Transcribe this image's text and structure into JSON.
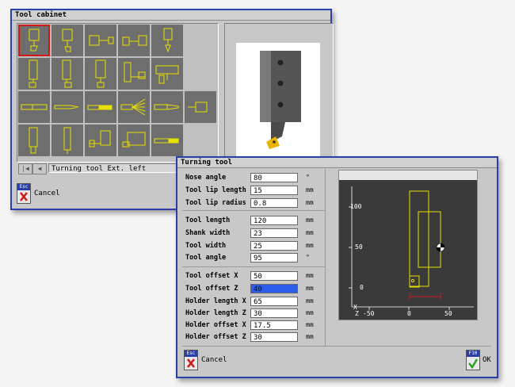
{
  "cabinet": {
    "title": "Tool cabinet",
    "selected_tool_label": "Turning tool Ext. left",
    "cancel_key": "Esc",
    "cancel_label": "Cancel",
    "nav_first_icon": "first-page-icon",
    "nav_prev_icon": "prev-page-icon"
  },
  "turning": {
    "title": "Turning tool",
    "fields": [
      {
        "label": "Nose angle",
        "value": "80",
        "unit": "°"
      },
      {
        "label": "Tool lip length",
        "value": "15",
        "unit": "mm"
      },
      {
        "label": "Tool lip radius",
        "value": "0.8",
        "unit": "mm"
      },
      {
        "label": "Tool length",
        "value": "120",
        "unit": "mm"
      },
      {
        "label": "Shank width",
        "value": "23",
        "unit": "mm"
      },
      {
        "label": "Tool width",
        "value": "25",
        "unit": "mm"
      },
      {
        "label": "Tool angle",
        "value": "95",
        "unit": "°"
      },
      {
        "label": "Tool offset X",
        "value": "50",
        "unit": "mm"
      },
      {
        "label": "Tool offset Z",
        "value": "40",
        "unit": "mm"
      },
      {
        "label": "Holder length X",
        "value": "65",
        "unit": "mm"
      },
      {
        "label": "Holder length Z",
        "value": "30",
        "unit": "mm"
      },
      {
        "label": "Holder offset X",
        "value": "17.5",
        "unit": "mm"
      },
      {
        "label": "Holder offset Z",
        "value": "30",
        "unit": "mm"
      }
    ],
    "cancel_key": "Esc",
    "cancel_label": "Cancel",
    "ok_key": "F10",
    "ok_label": "OK",
    "graph": {
      "y_ticks": [
        "100",
        "50",
        "0"
      ],
      "x_ticks": [
        "0",
        "50"
      ],
      "x_axis_label": "X",
      "z_axis_label": "Z",
      "z_neg_tick": "-50"
    }
  },
  "colors": {
    "window_border": "#2a3fa8",
    "tool_outline": "#e8e000",
    "selection": "#d01818",
    "highlight_field": "#2a5ee8"
  }
}
